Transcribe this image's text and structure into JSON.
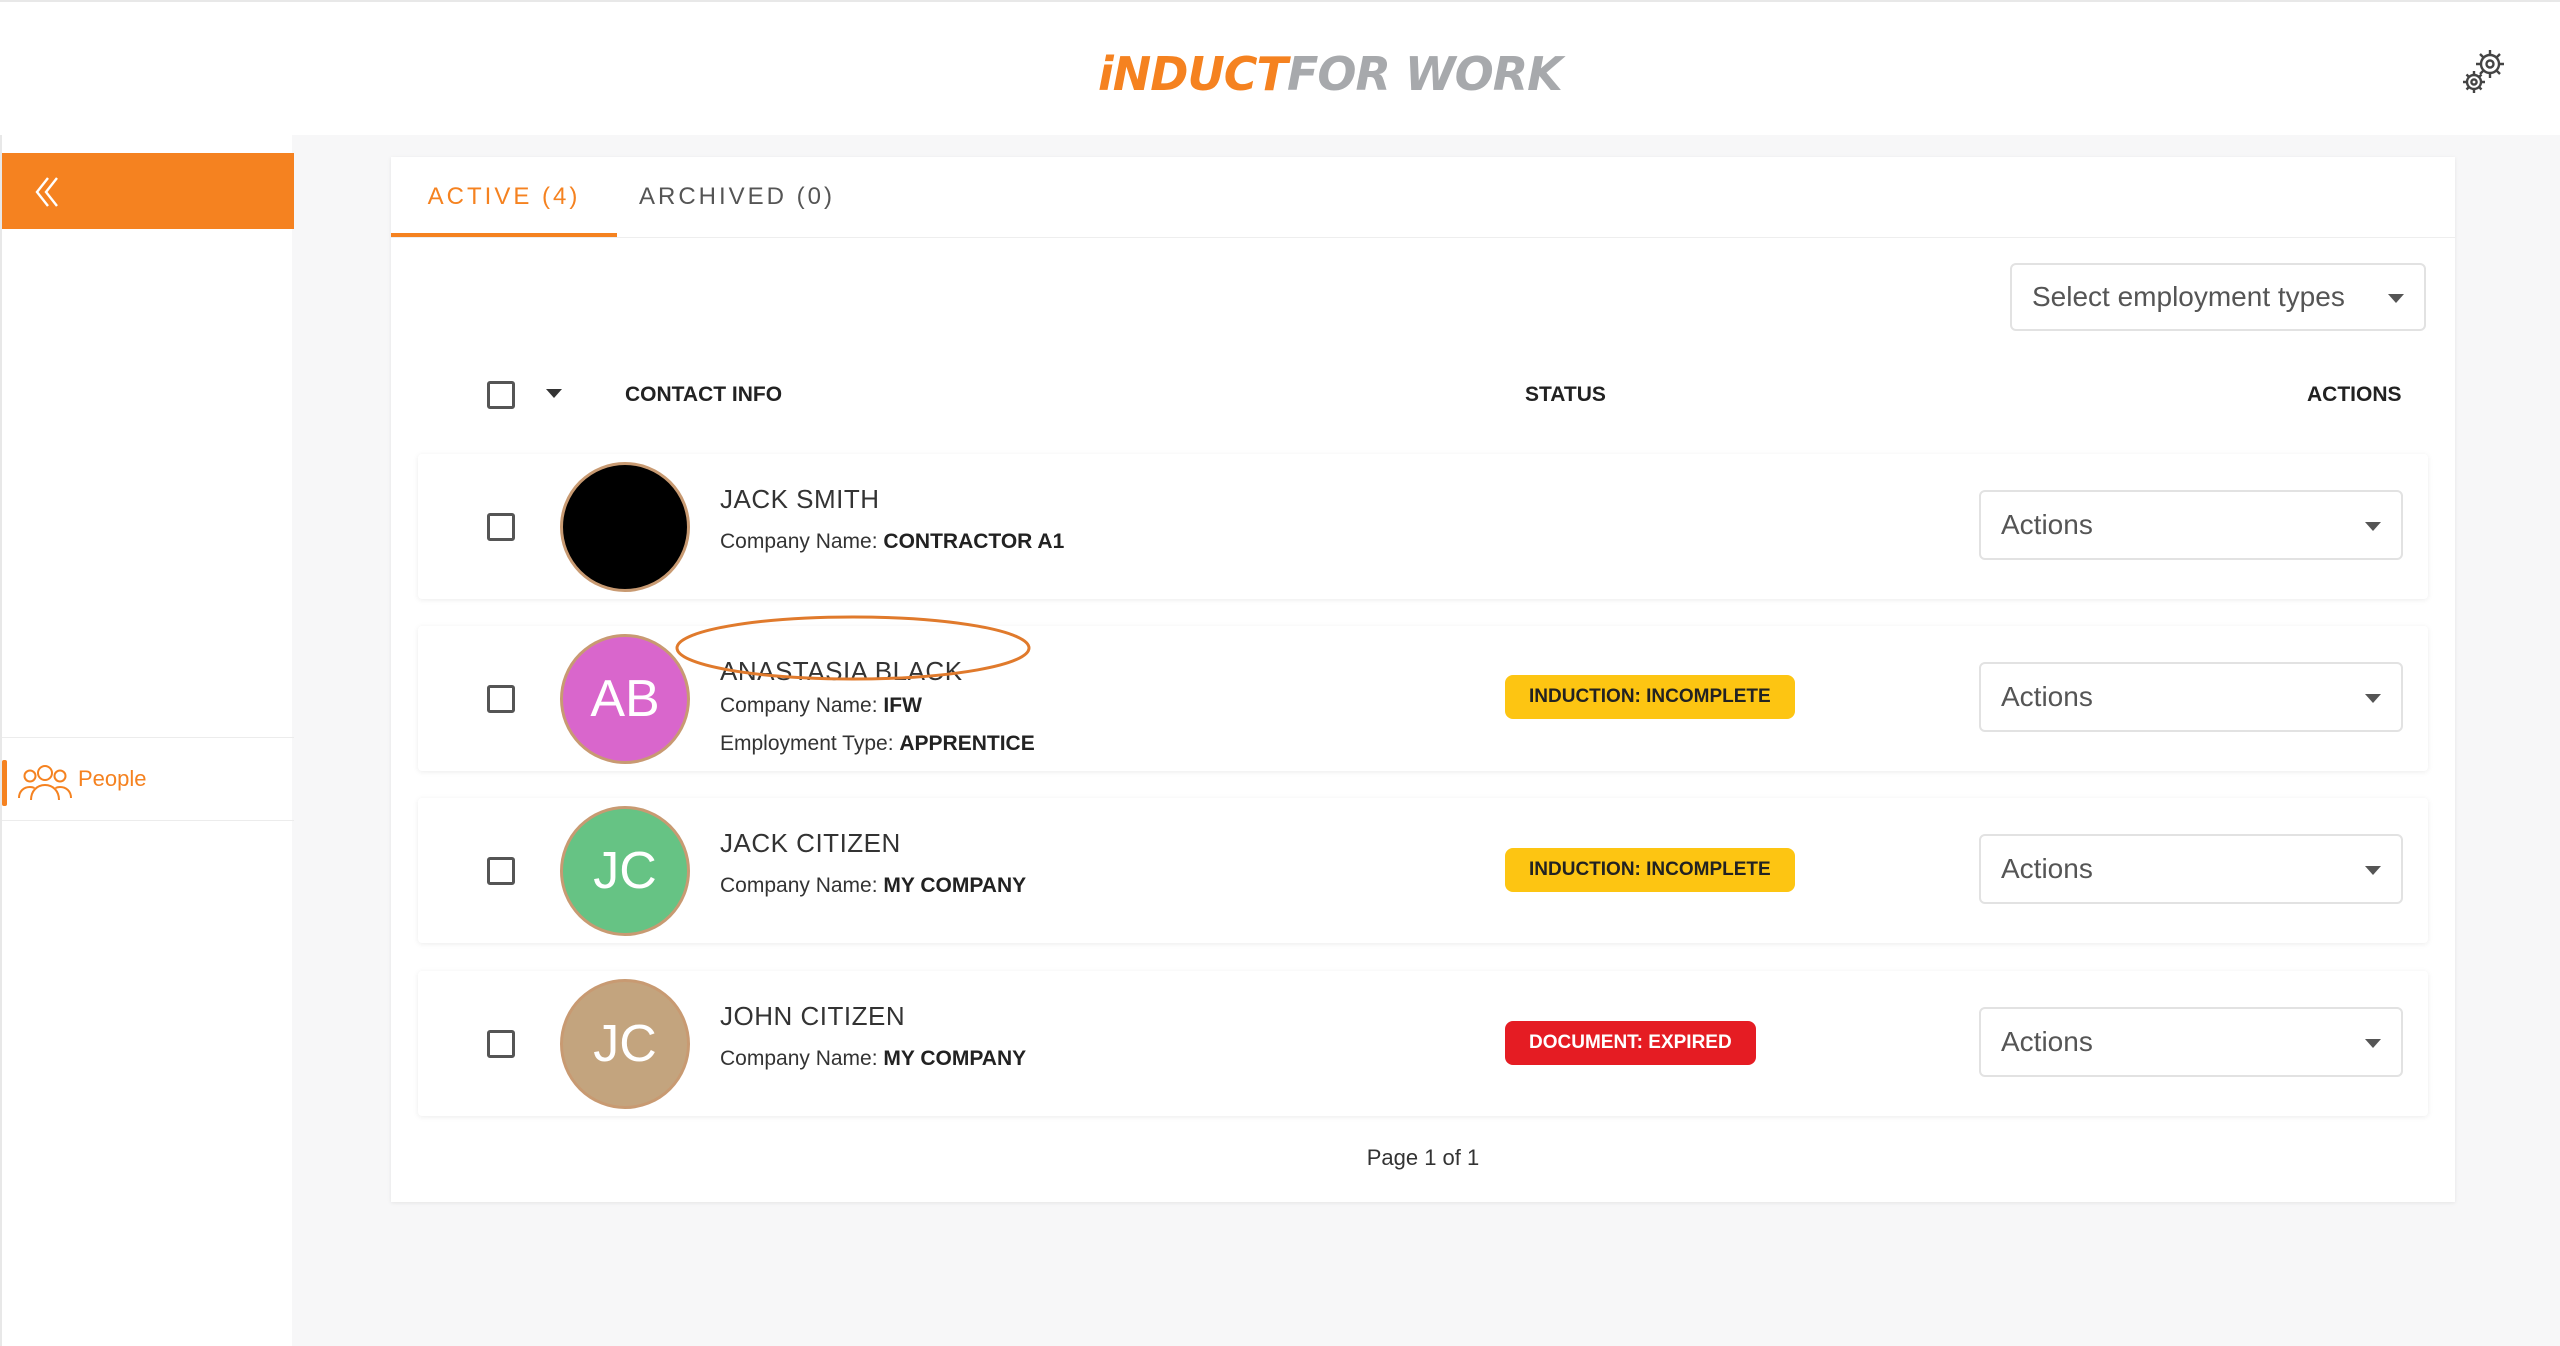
{
  "header": {
    "logo_part1": "iNDUCT",
    "logo_part2": "FOR WORK"
  },
  "sidebar": {
    "people_label": "People"
  },
  "tabs": [
    {
      "label": "ACTIVE (4)"
    },
    {
      "label": "ARCHIVED (0)"
    }
  ],
  "filter": {
    "employment_types_label": "Select employment types"
  },
  "table": {
    "columns": {
      "contact": "CONTACT INFO",
      "status": "STATUS",
      "actions": "ACTIONS"
    },
    "rows": [
      {
        "initials": "",
        "avatar_color": "#000000",
        "name": "JACK SMITH",
        "company_label": "Company Name:",
        "company": "CONTRACTOR A1",
        "status": "",
        "actions_label": "Actions"
      },
      {
        "initials": "AB",
        "avatar_color": "#d966cc",
        "name": "ANASTASIA BLACK",
        "company_label": "Company Name:",
        "company": "IFW",
        "employment_label": "Employment Type:",
        "employment": "APPRENTICE",
        "status": "INDUCTION: INCOMPLETE",
        "status_color": "#fdc512",
        "actions_label": "Actions"
      },
      {
        "initials": "JC",
        "avatar_color": "#66c384",
        "name": "JACK CITIZEN",
        "company_label": "Company Name:",
        "company": "MY COMPANY",
        "status": "INDUCTION: INCOMPLETE",
        "status_color": "#fdc512",
        "actions_label": "Actions"
      },
      {
        "initials": "JC",
        "avatar_color": "#c3a47e",
        "name": "JOHN CITIZEN",
        "company_label": "Company Name:",
        "company": "MY COMPANY",
        "status": "DOCUMENT: EXPIRED",
        "status_color": "#e51c23",
        "actions_label": "Actions"
      }
    ]
  },
  "pagination": {
    "label": "Page 1 of 1"
  },
  "colors": {
    "brand_orange": "#f58220",
    "logo_grey": "#a7a9ac"
  }
}
